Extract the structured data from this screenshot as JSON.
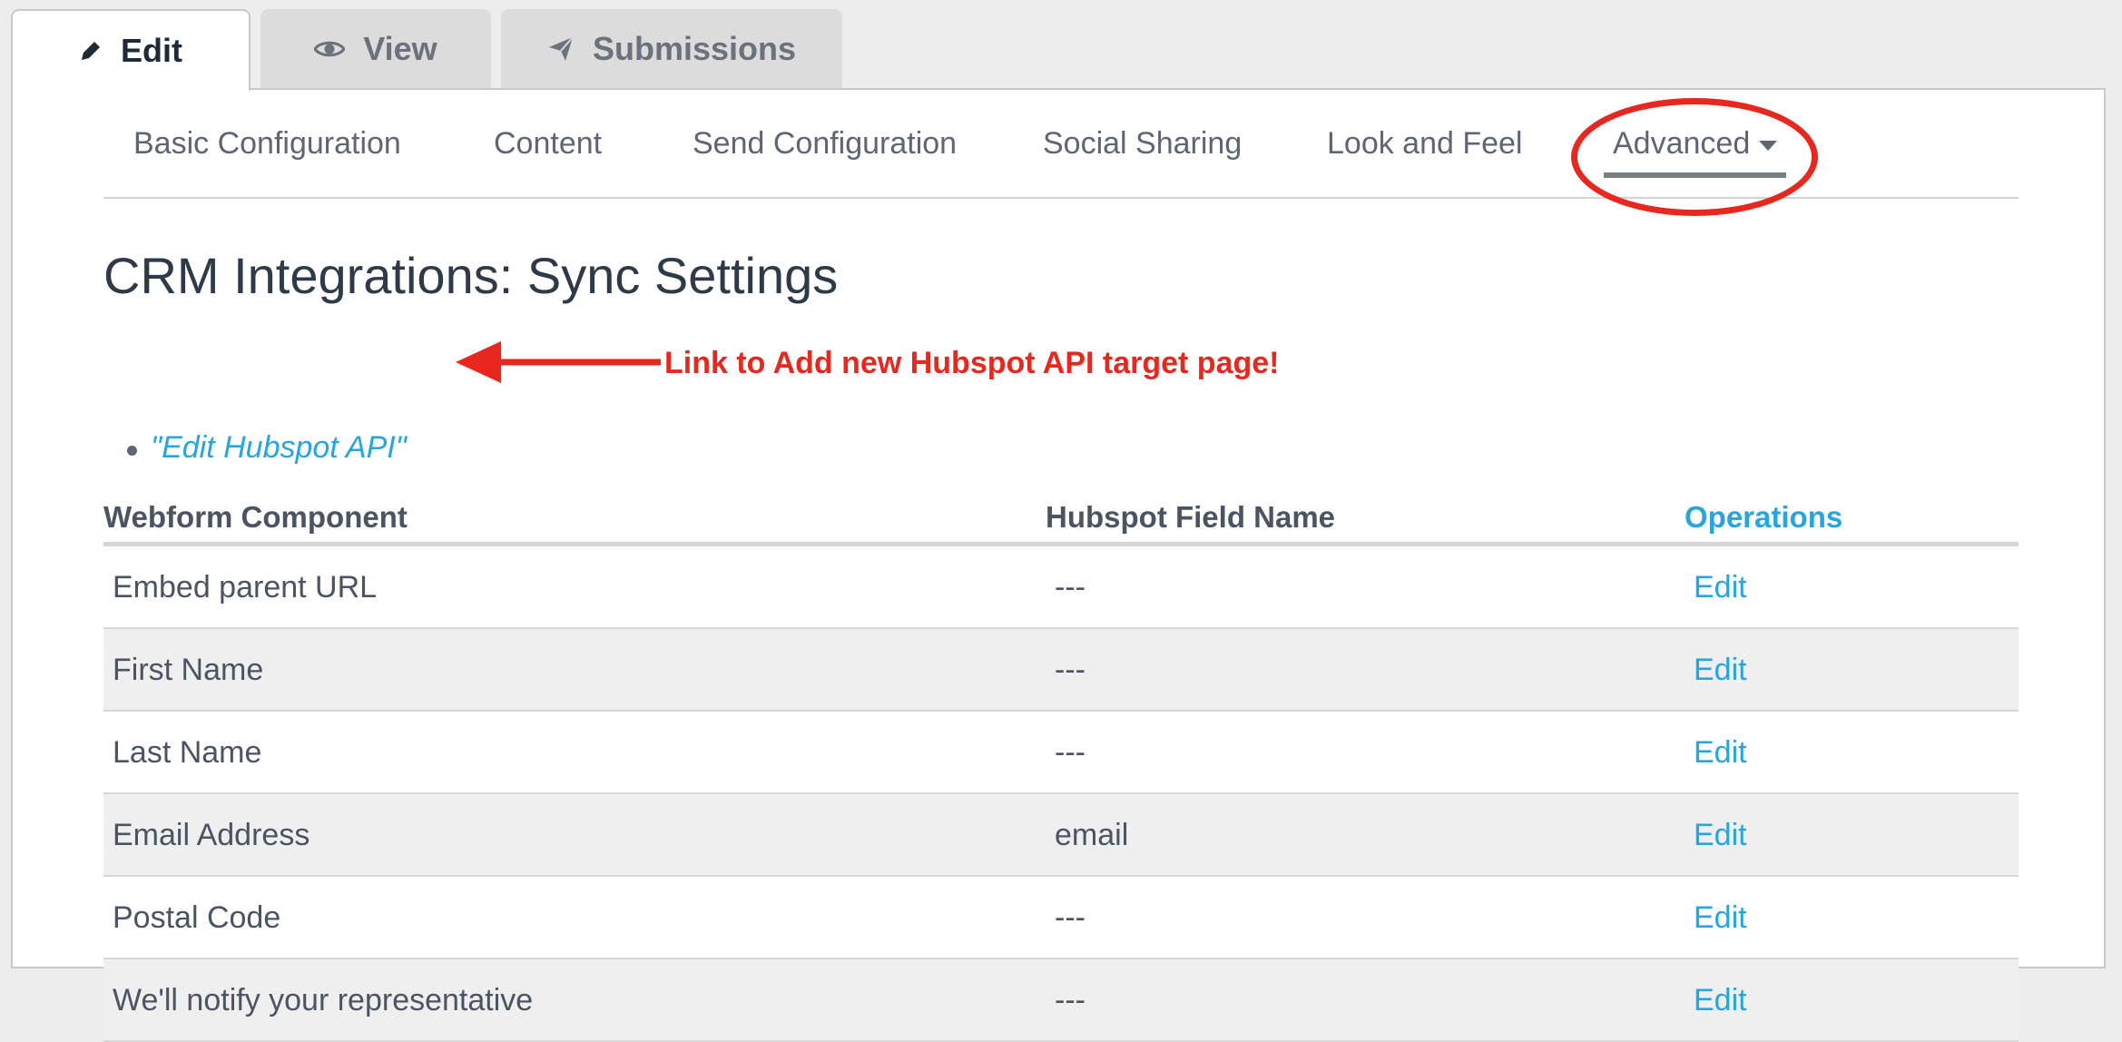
{
  "tabs": [
    {
      "label": "Edit",
      "icon": "pencil-icon",
      "active": true
    },
    {
      "label": "View",
      "icon": "eye-icon",
      "active": false
    },
    {
      "label": "Submissions",
      "icon": "paper-plane-icon",
      "active": false
    }
  ],
  "subnav": {
    "items": [
      "Basic Configuration",
      "Content",
      "Send Configuration",
      "Social Sharing",
      "Look and Feel",
      "Advanced"
    ]
  },
  "page": {
    "title": "CRM Integrations: Sync Settings",
    "link_label": "\"Edit Hubspot API\""
  },
  "annotation": {
    "text": "Link to Add new Hubspot API target page!",
    "color": "#e8281e"
  },
  "table": {
    "headers": [
      "Webform Component",
      "Hubspot Field Name",
      "Operations"
    ],
    "rows": [
      {
        "component": "Embed parent URL",
        "field": "---",
        "op": "Edit"
      },
      {
        "component": "First Name",
        "field": "---",
        "op": "Edit"
      },
      {
        "component": "Last Name",
        "field": "---",
        "op": "Edit"
      },
      {
        "component": "Email Address",
        "field": "email",
        "op": "Edit"
      },
      {
        "component": "Postal Code",
        "field": "---",
        "op": "Edit"
      },
      {
        "component": "We'll notify your representative",
        "field": "---",
        "op": "Edit"
      }
    ]
  },
  "colors": {
    "link": "#27a5dc",
    "text": "#4a5462",
    "annotation": "#e8281e"
  }
}
